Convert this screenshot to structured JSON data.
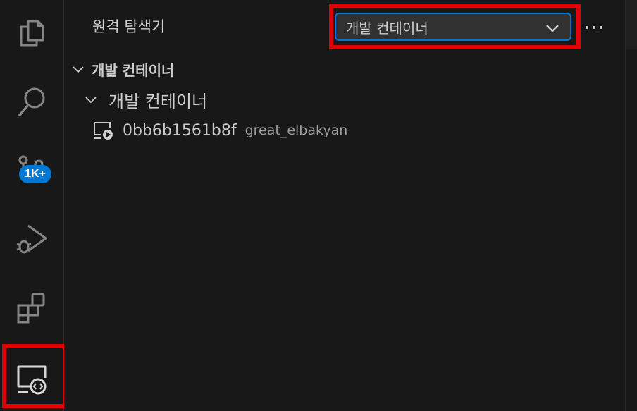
{
  "activity_bar": {
    "items": [
      {
        "name": "explorer",
        "icon": "files-icon"
      },
      {
        "name": "search",
        "icon": "search-icon"
      },
      {
        "name": "source-control",
        "icon": "source-control-icon",
        "badge": "1K+"
      },
      {
        "name": "run-debug",
        "icon": "run-debug-icon"
      },
      {
        "name": "extensions",
        "icon": "extensions-icon"
      },
      {
        "name": "remote-explorer",
        "icon": "remote-explorer-icon",
        "active": true
      }
    ]
  },
  "sidebar": {
    "title": "원격 탐색기",
    "remote_select": {
      "value": "개발 컨테이너"
    },
    "more_label": "···",
    "tree": {
      "section_label": "개발 컨테이너",
      "group_label": "개발 컨테이너",
      "container": {
        "id": "0bb6b1561b8f",
        "name": "great_elbakyan"
      }
    }
  },
  "colors": {
    "background": "#181818",
    "accent": "#0078d4",
    "highlight": "#e00000",
    "text": "#cccccc",
    "muted_text": "#9d9d9d"
  }
}
